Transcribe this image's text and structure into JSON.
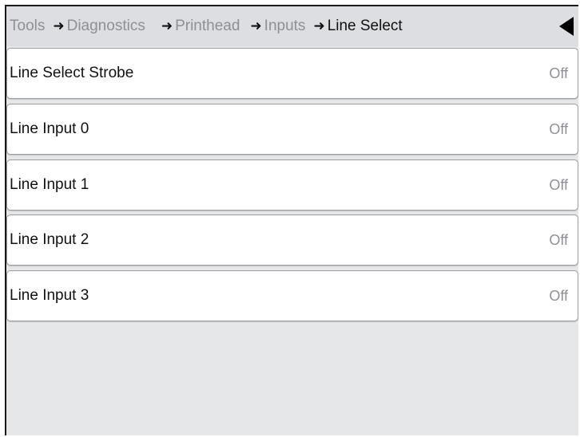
{
  "header": {
    "breadcrumb": [
      {
        "label": "Tools"
      },
      {
        "label": "Diagnostics"
      },
      {
        "label": "Printhead"
      },
      {
        "label": "Inputs"
      },
      {
        "label": "Line Select"
      }
    ],
    "arrow_glyph": "➜",
    "back_icon": "back-triangle-icon"
  },
  "list": {
    "items": [
      {
        "label": "Line Select Strobe",
        "value": "Off"
      },
      {
        "label": "Line Input 0",
        "value": "Off"
      },
      {
        "label": "Line Input 1",
        "value": "Off"
      },
      {
        "label": "Line Input 2",
        "value": "Off"
      },
      {
        "label": "Line Input 3",
        "value": "Off"
      }
    ]
  },
  "colors": {
    "background": "#e6e7e9",
    "header": "#dcdee2",
    "inactive_text": "#8e9095",
    "active_text": "#111111",
    "row_bg": "#ffffff"
  }
}
